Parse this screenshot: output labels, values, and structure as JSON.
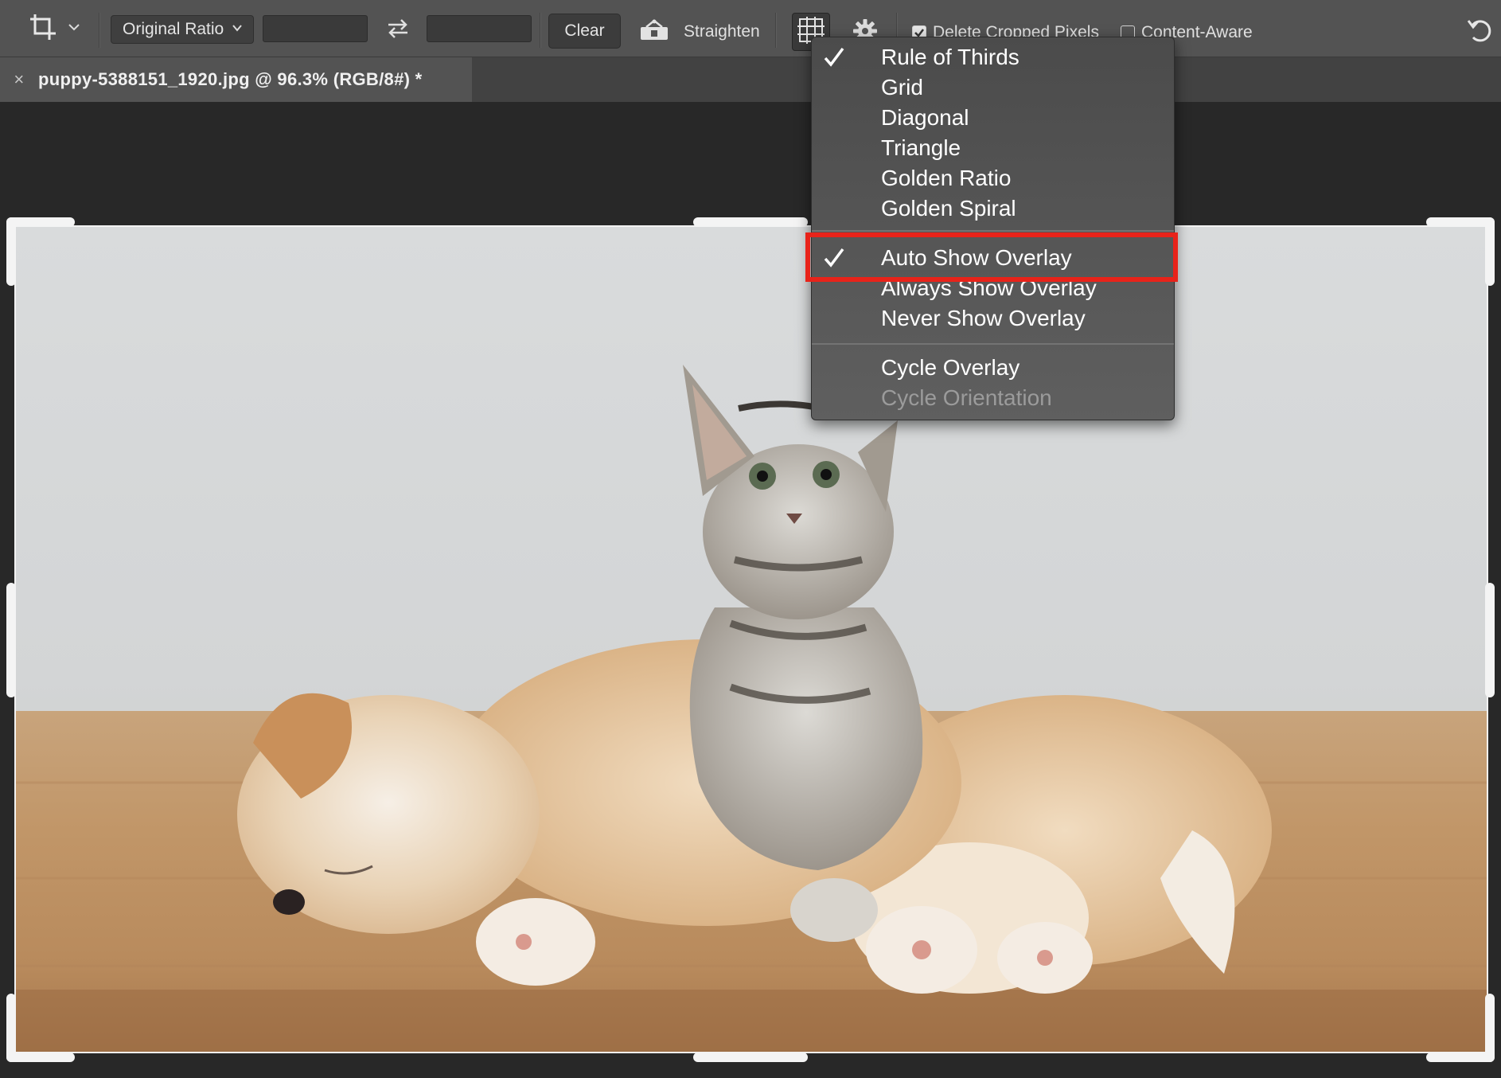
{
  "options_bar": {
    "ratio_select": "Original Ratio",
    "width_value": "",
    "height_value": "",
    "clear_label": "Clear",
    "straighten_label": "Straighten",
    "delete_cropped_label": "Delete Cropped Pixels",
    "content_aware_label": "Content-Aware",
    "delete_cropped_checked": true,
    "content_aware_checked": false,
    "icons": [
      "crop-icon",
      "chevron-down-icon",
      "swap-icon",
      "straighten-icon",
      "grid-overlay-icon",
      "gear-icon",
      "reset-icon"
    ]
  },
  "document_tab": {
    "close_glyph": "×",
    "title": "puppy-5388151_1920.jpg @ 96.3% (RGB/8#) *"
  },
  "overlay_menu": {
    "overlays": [
      {
        "label": "Rule of Thirds",
        "checked": true
      },
      {
        "label": "Grid",
        "checked": false
      },
      {
        "label": "Diagonal",
        "checked": false
      },
      {
        "label": "Triangle",
        "checked": false
      },
      {
        "label": "Golden Ratio",
        "checked": false
      },
      {
        "label": "Golden Spiral",
        "checked": false
      }
    ],
    "display_modes": [
      {
        "label": "Auto Show Overlay",
        "checked": true,
        "highlighted": true
      },
      {
        "label": "Always Show Overlay",
        "checked": false
      },
      {
        "label": "Never Show Overlay",
        "checked": false
      }
    ],
    "cycle": [
      {
        "label": "Cycle Overlay",
        "enabled": true
      },
      {
        "label": "Cycle Orientation",
        "enabled": false
      }
    ]
  },
  "colors": {
    "highlight": "#e8231a",
    "options_bar_bg": "#535353",
    "workspace_bg": "#282828",
    "menu_text": "#ffffff",
    "menu_disabled_text": "#9b9b9b"
  }
}
